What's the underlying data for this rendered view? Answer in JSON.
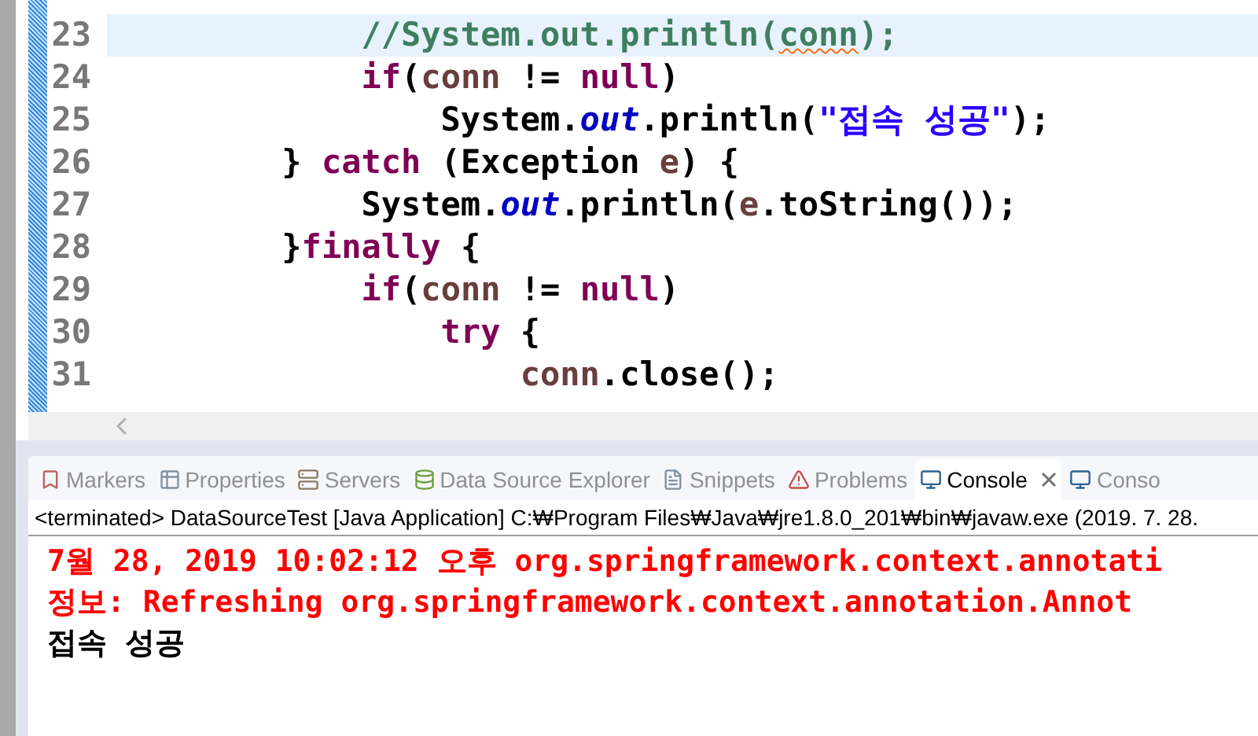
{
  "editor": {
    "lines": [
      {
        "number": "23",
        "current": true,
        "segments": [
          {
            "kind": "comment",
            "text": "            //System.out.println("
          },
          {
            "kind": "misspelled",
            "text": "conn"
          },
          {
            "kind": "comment",
            "text": ");"
          }
        ]
      },
      {
        "number": "24",
        "current": false,
        "segments": [
          {
            "kind": "keyword",
            "text": "            if"
          },
          {
            "kind": "plain",
            "text": "("
          },
          {
            "kind": "variable",
            "text": "conn"
          },
          {
            "kind": "plain",
            "text": " != "
          },
          {
            "kind": "keyword",
            "text": "null"
          },
          {
            "kind": "plain",
            "text": ")"
          }
        ]
      },
      {
        "number": "25",
        "current": false,
        "segments": [
          {
            "kind": "plain",
            "text": "                System."
          },
          {
            "kind": "field",
            "text": "out"
          },
          {
            "kind": "plain",
            "text": ".println("
          },
          {
            "kind": "string",
            "text": "\"접속 성공\""
          },
          {
            "kind": "plain",
            "text": ");"
          }
        ]
      },
      {
        "number": "26",
        "current": false,
        "segments": [
          {
            "kind": "plain",
            "text": "        } "
          },
          {
            "kind": "keyword",
            "text": "catch"
          },
          {
            "kind": "plain",
            "text": " (Exception "
          },
          {
            "kind": "variable",
            "text": "e"
          },
          {
            "kind": "plain",
            "text": ") {"
          }
        ]
      },
      {
        "number": "27",
        "current": false,
        "segments": [
          {
            "kind": "plain",
            "text": "            System."
          },
          {
            "kind": "field",
            "text": "out"
          },
          {
            "kind": "plain",
            "text": ".println("
          },
          {
            "kind": "variable",
            "text": "e"
          },
          {
            "kind": "plain",
            "text": ".toString());"
          }
        ]
      },
      {
        "number": "28",
        "current": false,
        "segments": [
          {
            "kind": "plain",
            "text": "        }"
          },
          {
            "kind": "keyword",
            "text": "finally"
          },
          {
            "kind": "plain",
            "text": " {"
          }
        ]
      },
      {
        "number": "29",
        "current": false,
        "segments": [
          {
            "kind": "keyword",
            "text": "            if"
          },
          {
            "kind": "plain",
            "text": "("
          },
          {
            "kind": "variable",
            "text": "conn"
          },
          {
            "kind": "plain",
            "text": " != "
          },
          {
            "kind": "keyword",
            "text": "null"
          },
          {
            "kind": "plain",
            "text": ")"
          }
        ]
      },
      {
        "number": "30",
        "current": false,
        "segments": [
          {
            "kind": "keyword",
            "text": "                try"
          },
          {
            "kind": "plain",
            "text": " {"
          }
        ]
      },
      {
        "number": "31",
        "current": false,
        "segments": [
          {
            "kind": "variable",
            "text": "                    conn"
          },
          {
            "kind": "plain",
            "text": ".close();"
          }
        ]
      }
    ]
  },
  "tabs": [
    {
      "label": "Markers",
      "selected": false
    },
    {
      "label": "Properties",
      "selected": false
    },
    {
      "label": "Servers",
      "selected": false
    },
    {
      "label": "Data Source Explorer",
      "selected": false
    },
    {
      "label": "Snippets",
      "selected": false
    },
    {
      "label": "Problems",
      "selected": false
    },
    {
      "label": "Console",
      "selected": true
    },
    {
      "label": "Conso",
      "selected": false
    }
  ],
  "console": {
    "status": "<terminated> DataSourceTest [Java Application] C:₩Program Files₩Java₩jre1.8.0_201₩bin₩javaw.exe (2019. 7. 28.",
    "lines": [
      {
        "kind": "stderr",
        "text": "7월 28, 2019 10:02:12 오후 org.springframework.context.annotati"
      },
      {
        "kind": "stderr",
        "text": "정보: Refreshing org.springframework.context.annotation.Annot"
      },
      {
        "kind": "stdout",
        "text": "접속 성공"
      }
    ]
  }
}
